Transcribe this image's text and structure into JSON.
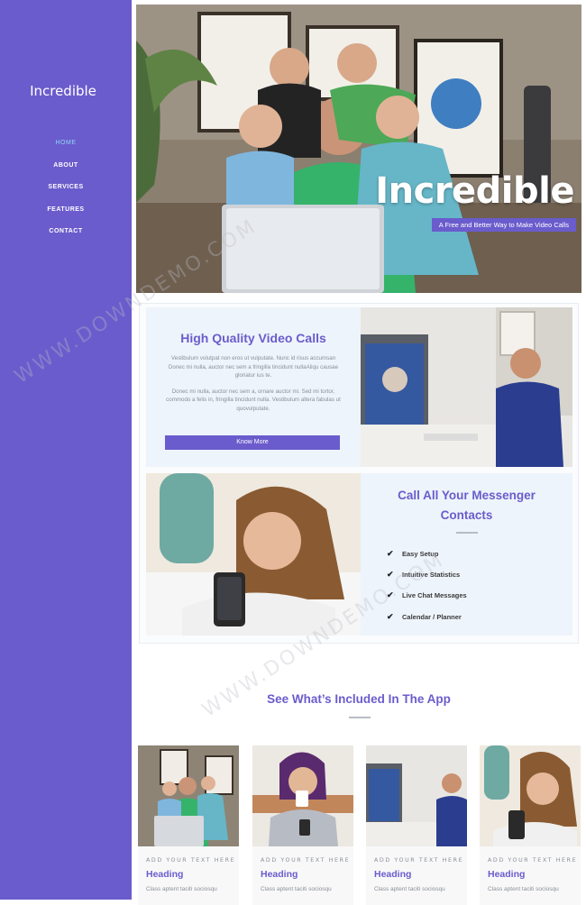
{
  "sidebar": {
    "brand": "Incredible",
    "nav": [
      {
        "label": "HOME",
        "active": true
      },
      {
        "label": "ABOUT",
        "active": false
      },
      {
        "label": "SERVICES",
        "active": false
      },
      {
        "label": "FEATURES",
        "active": false
      },
      {
        "label": "CONTACT",
        "active": false
      }
    ]
  },
  "hero": {
    "title": "Incredible",
    "subtitle": "A Free and Better Way to Make Video Calls"
  },
  "features": {
    "video_calls": {
      "heading": "High Quality Video Calls",
      "para1": "Vestibulum volutpat non eros ut vulputate. Nunc id risus accumsan Donec mi nulla, auctor nec sem a fringilla tincidunt nullaAliqu causae gloriatur ius te.",
      "para2": "Donec mi nulla, auctor nec sem a, ornare auctor mi. Sed mi tortor, commodo a felis in, fringilla tincidunt nulla. Vestibulum altera fabulas ut quovulputate.",
      "button": "Know More"
    },
    "contacts": {
      "heading": "Call All Your Messenger Contacts",
      "items": [
        "Easy Setup",
        "Intuitive Statistics",
        "Live Chat Messages",
        "Calendar / Planner"
      ]
    }
  },
  "included": {
    "heading": "See What’s Included In The App",
    "cards": [
      {
        "kicker": "ADD YOUR TEXT HERE",
        "heading": "Heading",
        "text": "Class aptent taciti sociosqu"
      },
      {
        "kicker": "ADD YOUR TEXT HERE",
        "heading": "Heading",
        "text": "Class aptent taciti sociosqu"
      },
      {
        "kicker": "ADD YOUR TEXT HERE",
        "heading": "Heading",
        "text": "Class aptent taciti sociosqu"
      },
      {
        "kicker": "ADD YOUR TEXT HERE",
        "heading": "Heading",
        "text": "Class aptent taciti sociosqu"
      }
    ]
  },
  "watermark": "WWW.DOWNDEMO.COM",
  "colors": {
    "accent": "#6a5ccc",
    "nav_active": "#8fd3f5",
    "panel_bg": "#eef4fb"
  }
}
